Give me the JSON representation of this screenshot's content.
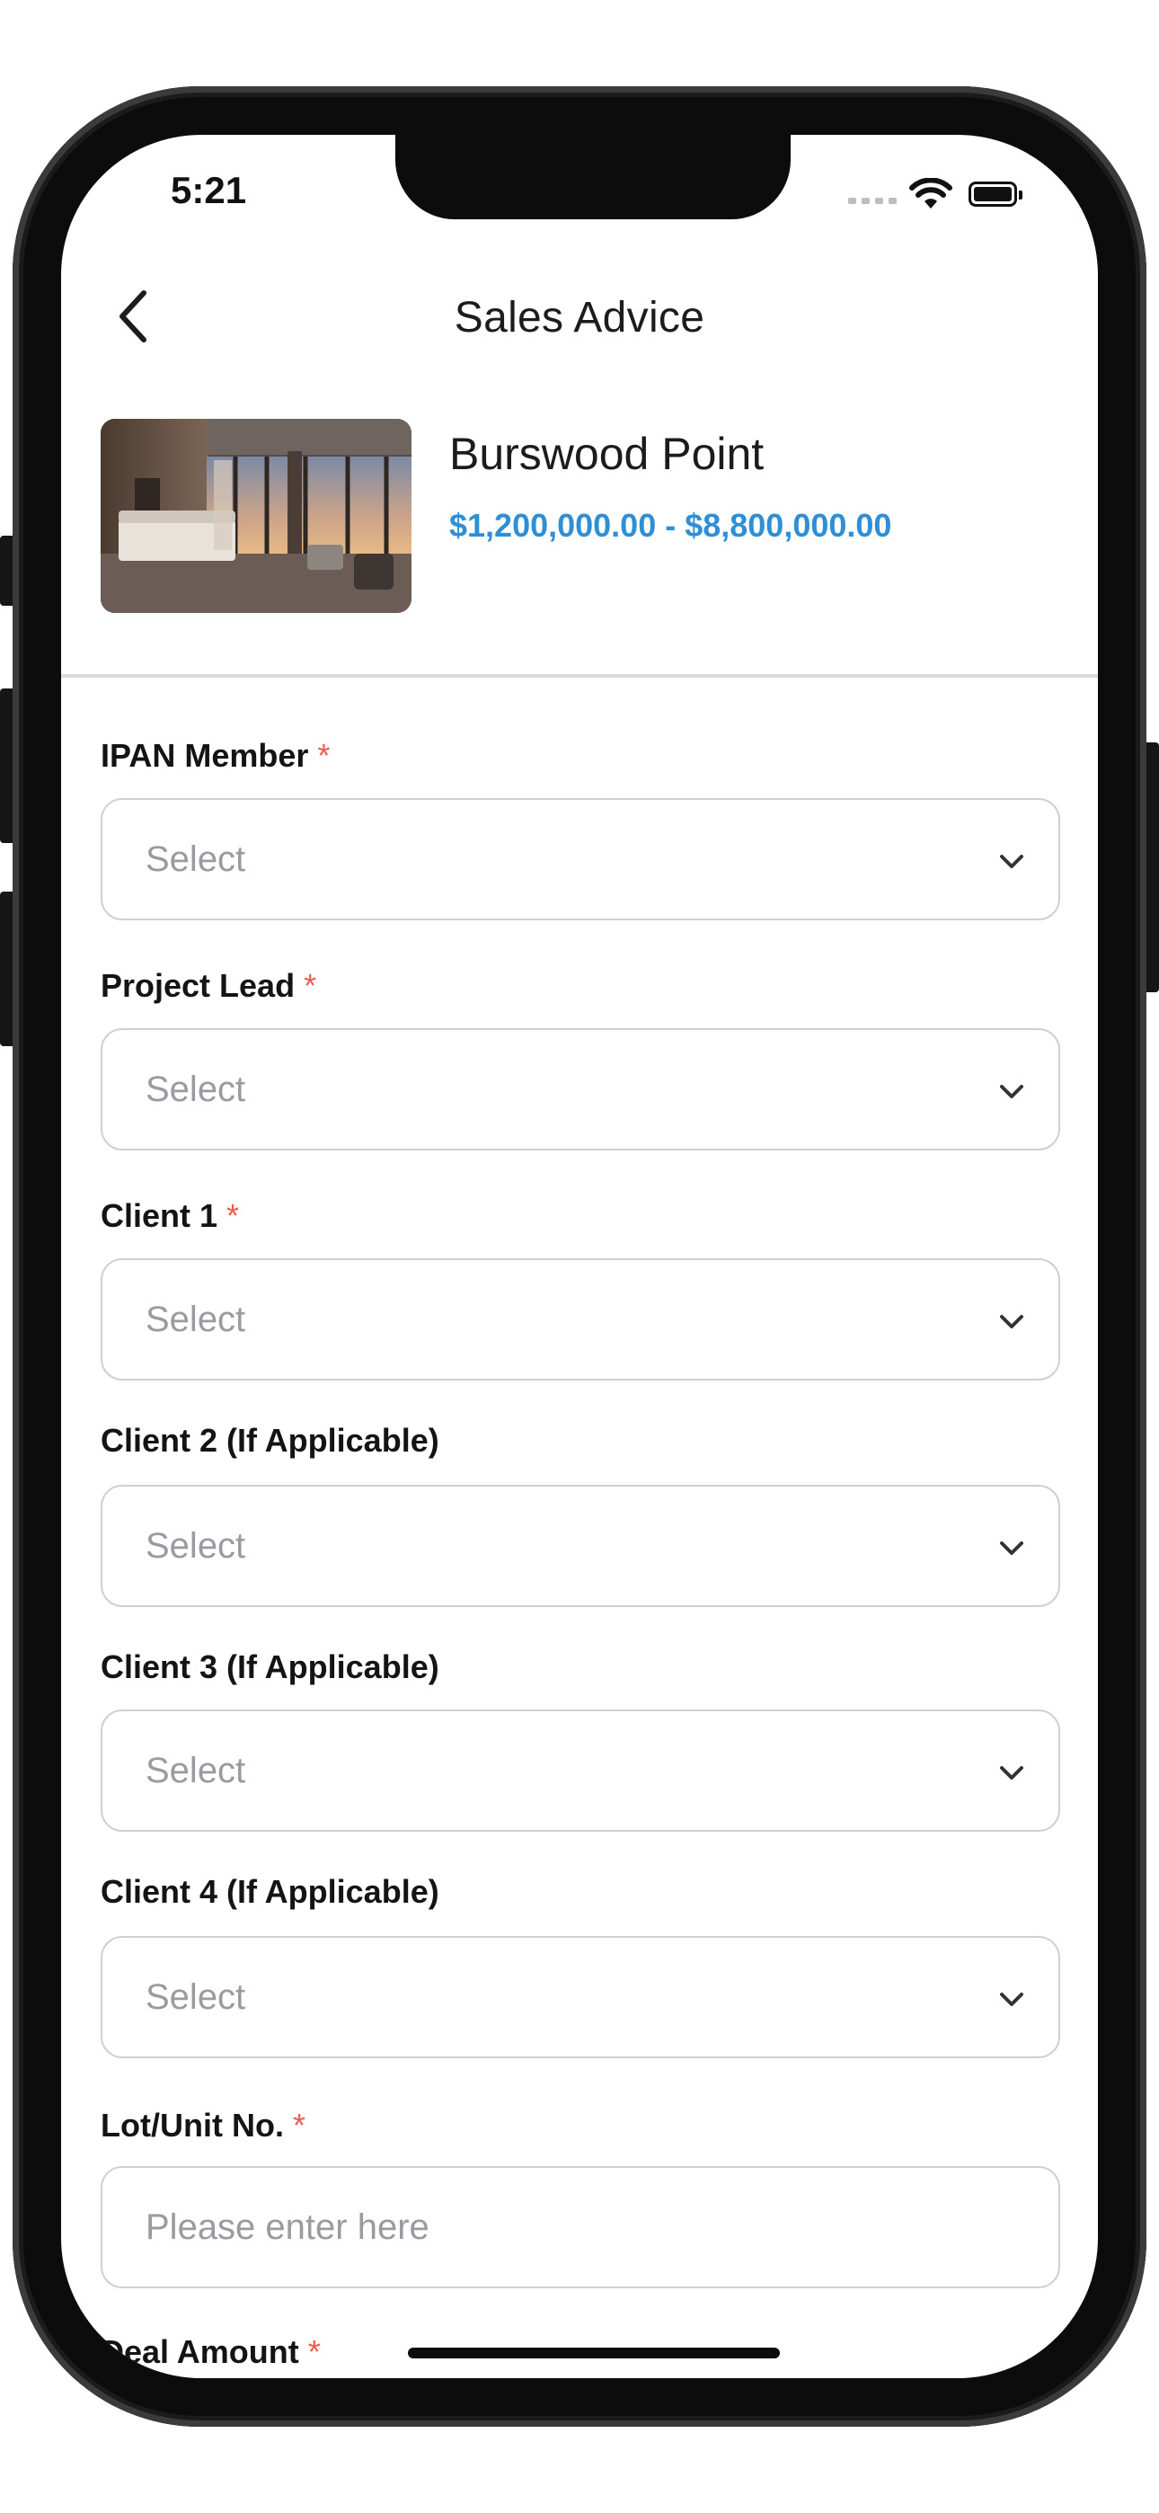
{
  "status_bar": {
    "time": "5:21"
  },
  "header": {
    "title": "Sales Advice"
  },
  "project": {
    "name": "Burswood Point",
    "price_range": "$1,200,000.00 - $8,800,000.00"
  },
  "form": {
    "required_mark": "*",
    "fields": [
      {
        "label": "IPAN Member",
        "placeholder": "Select",
        "type": "select"
      },
      {
        "label": "Project Lead",
        "placeholder": "Select",
        "type": "select"
      },
      {
        "label": "Client 1",
        "placeholder": "Select",
        "type": "select"
      },
      {
        "label": "Client 2 (If Applicable)",
        "placeholder": "Select",
        "type": "select"
      },
      {
        "label": "Client 3 (If Applicable)",
        "placeholder": "Select",
        "type": "select"
      },
      {
        "label": "Client 4 (If Applicable)",
        "placeholder": "Select",
        "type": "select"
      },
      {
        "label": "Lot/Unit No.",
        "placeholder": "Please enter here",
        "type": "text"
      },
      {
        "label": "Deal Amount",
        "type": "text"
      }
    ]
  },
  "colors": {
    "accent_price": "#2f8fd6",
    "required_star": "#ec5c4f",
    "border": "#cfcfd4"
  },
  "icons": [
    "back-chevron-icon",
    "chevron-down-icon",
    "wifi-icon",
    "battery-icon",
    "signal-icon"
  ]
}
